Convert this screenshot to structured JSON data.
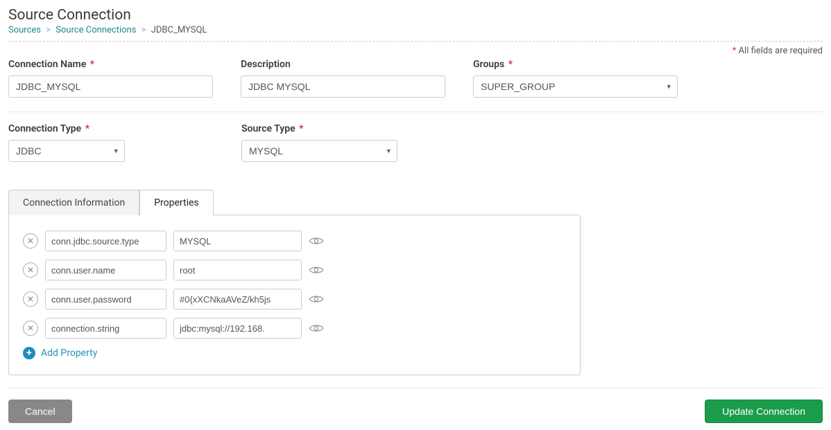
{
  "page_title": "Source Connection",
  "breadcrumb": {
    "items": [
      "Sources",
      "Source Connections"
    ],
    "current": "JDBC_MYSQL"
  },
  "required_note": "All fields are required",
  "fields": {
    "connection_name": {
      "label": "Connection Name",
      "value": "JDBC_MYSQL",
      "required": true
    },
    "description": {
      "label": "Description",
      "value": "JDBC MYSQL",
      "required": false
    },
    "groups": {
      "label": "Groups",
      "value": "SUPER_GROUP",
      "required": true
    },
    "connection_type": {
      "label": "Connection Type",
      "value": "JDBC",
      "required": true
    },
    "source_type": {
      "label": "Source Type",
      "value": "MYSQL",
      "required": true
    }
  },
  "tabs": {
    "connection_info": "Connection Information",
    "properties": "Properties"
  },
  "properties": [
    {
      "key": "conn.jdbc.source.type",
      "value": "MYSQL"
    },
    {
      "key": "conn.user.name",
      "value": "root"
    },
    {
      "key": "conn.user.password",
      "value": "#0{xXCNkaAVeZ/kh5js"
    },
    {
      "key": "connection.string",
      "value": "jdbc:mysql://192.168."
    }
  ],
  "add_property_label": "Add Property",
  "footer": {
    "cancel": "Cancel",
    "submit": "Update Connection"
  }
}
